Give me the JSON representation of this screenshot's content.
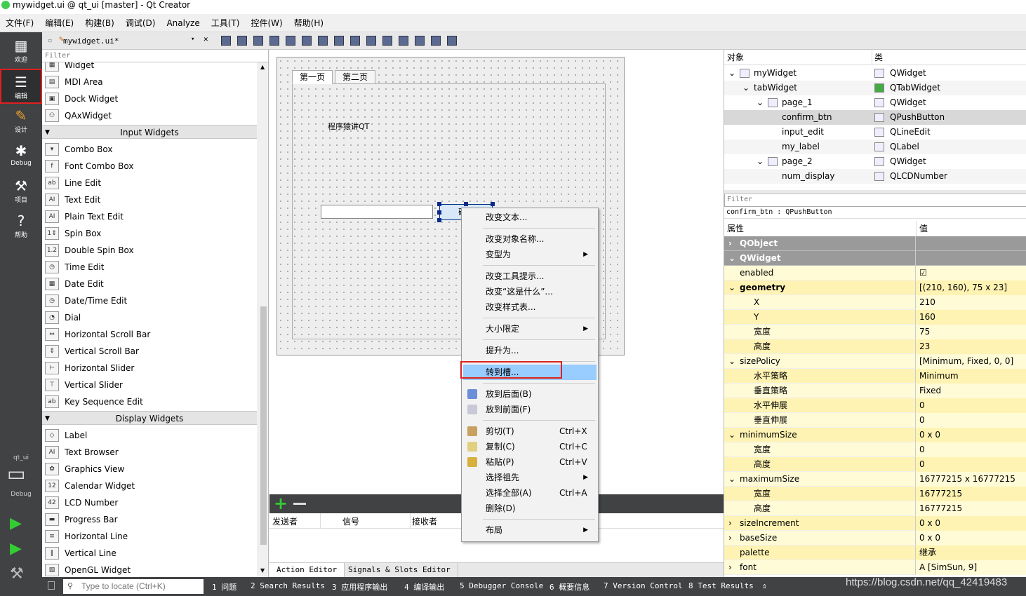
{
  "window": {
    "title": "mywidget.ui @ qt_ui [master] - Qt Creator"
  },
  "menu": [
    "文件(F)",
    "编辑(E)",
    "构建(B)",
    "调试(D)",
    "Analyze",
    "工具(T)",
    "控件(W)",
    "帮助(H)"
  ],
  "modes": [
    {
      "label": "欢迎",
      "icon": "grid-icon"
    },
    {
      "label": "编辑",
      "icon": "edit-doc-icon"
    },
    {
      "label": "设计",
      "icon": "pencil-icon"
    },
    {
      "label": "Debug",
      "icon": "bug-icon"
    },
    {
      "label": "项目",
      "icon": "wrench-icon"
    },
    {
      "label": "帮助",
      "icon": "help-icon"
    }
  ],
  "kit": {
    "project": "qt_ui",
    "config": "Debug"
  },
  "editor": {
    "document": "mywidget.ui*"
  },
  "widgetbox": {
    "filter_placeholder": "Filter",
    "top_items": [
      {
        "label": "Widget",
        "icon": "▦"
      },
      {
        "label": "MDI Area",
        "icon": "▤"
      },
      {
        "label": "Dock Widget",
        "icon": "▣"
      },
      {
        "label": "QAxWidget",
        "icon": "⚇"
      }
    ],
    "input_title": "Input Widgets",
    "input_items": [
      {
        "label": "Combo Box",
        "icon": "▾"
      },
      {
        "label": "Font Combo Box",
        "icon": "f"
      },
      {
        "label": "Line Edit",
        "icon": "ab"
      },
      {
        "label": "Text Edit",
        "icon": "AI"
      },
      {
        "label": "Plain Text Edit",
        "icon": "AI"
      },
      {
        "label": "Spin Box",
        "icon": "1⇕"
      },
      {
        "label": "Double Spin Box",
        "icon": "1.2"
      },
      {
        "label": "Time Edit",
        "icon": "◷"
      },
      {
        "label": "Date Edit",
        "icon": "▦"
      },
      {
        "label": "Date/Time Edit",
        "icon": "◷"
      },
      {
        "label": "Dial",
        "icon": "◔"
      },
      {
        "label": "Horizontal Scroll Bar",
        "icon": "⇔"
      },
      {
        "label": "Vertical Scroll Bar",
        "icon": "⇕"
      },
      {
        "label": "Horizontal Slider",
        "icon": "⊢"
      },
      {
        "label": "Vertical Slider",
        "icon": "⊤"
      },
      {
        "label": "Key Sequence Edit",
        "icon": "ab"
      }
    ],
    "display_title": "Display Widgets",
    "display_items": [
      {
        "label": "Label",
        "icon": "◇"
      },
      {
        "label": "Text Browser",
        "icon": "AI"
      },
      {
        "label": "Graphics View",
        "icon": "✿"
      },
      {
        "label": "Calendar Widget",
        "icon": "12"
      },
      {
        "label": "LCD Number",
        "icon": "42"
      },
      {
        "label": "Progress Bar",
        "icon": "▬"
      },
      {
        "label": "Horizontal Line",
        "icon": "≡"
      },
      {
        "label": "Vertical Line",
        "icon": "‖"
      },
      {
        "label": "OpenGL Widget",
        "icon": "▨"
      }
    ]
  },
  "form": {
    "tabs": [
      "第一页",
      "第二页"
    ],
    "label_text": "程序猿讲QT",
    "button_text": "确定"
  },
  "context_menu": {
    "items": [
      {
        "label": "改变文本...",
        "sc": "",
        "sub": false,
        "sep_after": true
      },
      {
        "label": "改变对象名称...",
        "sc": "",
        "sub": false,
        "sep_after": false
      },
      {
        "label": "变型为",
        "sc": "",
        "sub": true,
        "sep_after": true
      },
      {
        "label": "改变工具提示...",
        "sc": "",
        "sub": false,
        "sep_after": false
      },
      {
        "label": "改变“这是什么”...",
        "sc": "",
        "sub": false,
        "sep_after": false
      },
      {
        "label": "改变样式表...",
        "sc": "",
        "sub": false,
        "sep_after": true
      },
      {
        "label": "大小限定",
        "sc": "",
        "sub": true,
        "sep_after": true
      },
      {
        "label": "提升为...",
        "sc": "",
        "sub": false,
        "sep_after": true
      },
      {
        "label": "转到槽...",
        "sc": "",
        "sub": false,
        "sep_after": true,
        "hl": true
      },
      {
        "label": "放到后面(B)",
        "sc": "",
        "sub": false,
        "sep_after": false,
        "icon": "#6a8ed8"
      },
      {
        "label": "放到前面(F)",
        "sc": "",
        "sub": false,
        "sep_after": true,
        "icon": "#c8c8d8"
      },
      {
        "label": "剪切(T)",
        "sc": "Ctrl+X",
        "sub": false,
        "sep_after": false,
        "icon": "#c8a060"
      },
      {
        "label": "复制(C)",
        "sc": "Ctrl+C",
        "sub": false,
        "sep_after": false,
        "icon": "#e0d080"
      },
      {
        "label": "粘贴(P)",
        "sc": "Ctrl+V",
        "sub": false,
        "sep_after": false,
        "icon": "#d8b040"
      },
      {
        "label": "选择祖先",
        "sc": "",
        "sub": true,
        "sep_after": false
      },
      {
        "label": "选择全部(A)",
        "sc": "Ctrl+A",
        "sub": false,
        "sep_after": false
      },
      {
        "label": "删除(D)",
        "sc": "",
        "sub": false,
        "sep_after": true
      },
      {
        "label": "布局",
        "sc": "",
        "sub": true,
        "sep_after": false
      }
    ]
  },
  "signals": {
    "columns": [
      "发送者",
      "信号",
      "接收者"
    ]
  },
  "bottom_tabs": [
    "Action Editor",
    "Signals & Slots Editor"
  ],
  "object_inspector": {
    "col_object": "对象",
    "col_class": "类",
    "rows": [
      {
        "name": "myWidget",
        "cls": "QWidget",
        "indent": 0,
        "exp": "⌄"
      },
      {
        "name": "tabWidget",
        "cls": "QTabWidget",
        "indent": 1,
        "exp": "⌄"
      },
      {
        "name": "page_1",
        "cls": "QWidget",
        "indent": 2,
        "exp": "⌄"
      },
      {
        "name": "confirm_btn",
        "cls": "QPushButton",
        "indent": 3,
        "exp": "",
        "sel": true
      },
      {
        "name": "input_edit",
        "cls": "QLineEdit",
        "indent": 3,
        "exp": ""
      },
      {
        "name": "my_label",
        "cls": "QLabel",
        "indent": 3,
        "exp": ""
      },
      {
        "name": "page_2",
        "cls": "QWidget",
        "indent": 2,
        "exp": "⌄"
      },
      {
        "name": "num_display",
        "cls": "QLCDNumber",
        "indent": 3,
        "exp": ""
      }
    ]
  },
  "property_editor": {
    "filter_placeholder": "Filter",
    "current": "confirm_btn : QPushButton",
    "col_prop": "属性",
    "col_value": "值",
    "rows": [
      {
        "n": "QObject",
        "v": "",
        "t": "grp",
        "exp": "›"
      },
      {
        "n": "QWidget",
        "v": "",
        "t": "grp",
        "exp": "⌄"
      },
      {
        "n": "enabled",
        "v": "☑",
        "t": "py",
        "i": 1
      },
      {
        "n": "geometry",
        "v": "[(210, 160), 75 x 23]",
        "t": "py2",
        "i": 0,
        "b": true,
        "exp": "⌄"
      },
      {
        "n": "X",
        "v": "210",
        "t": "py",
        "i": 2
      },
      {
        "n": "Y",
        "v": "160",
        "t": "py2",
        "i": 2
      },
      {
        "n": "宽度",
        "v": "75",
        "t": "py",
        "i": 2
      },
      {
        "n": "高度",
        "v": "23",
        "t": "py2",
        "i": 2
      },
      {
        "n": "sizePolicy",
        "v": "[Minimum, Fixed, 0, 0]",
        "t": "py",
        "i": 1,
        "exp": "⌄"
      },
      {
        "n": "水平策略",
        "v": "Minimum",
        "t": "py2",
        "i": 2
      },
      {
        "n": "垂直策略",
        "v": "Fixed",
        "t": "py",
        "i": 2
      },
      {
        "n": "水平伸展",
        "v": "0",
        "t": "py2",
        "i": 2
      },
      {
        "n": "垂直伸展",
        "v": "0",
        "t": "py",
        "i": 2
      },
      {
        "n": "minimumSize",
        "v": "0 x 0",
        "t": "py2",
        "i": 1,
        "exp": "⌄"
      },
      {
        "n": "宽度",
        "v": "0",
        "t": "py",
        "i": 2
      },
      {
        "n": "高度",
        "v": "0",
        "t": "py2",
        "i": 2
      },
      {
        "n": "maximumSize",
        "v": "16777215 x 16777215",
        "t": "py",
        "i": 1,
        "exp": "⌄"
      },
      {
        "n": "宽度",
        "v": "16777215",
        "t": "py2",
        "i": 2
      },
      {
        "n": "高度",
        "v": "16777215",
        "t": "py",
        "i": 2
      },
      {
        "n": "sizeIncrement",
        "v": "0 x 0",
        "t": "py2",
        "i": 1,
        "exp": "›"
      },
      {
        "n": "baseSize",
        "v": "0 x 0",
        "t": "py",
        "i": 1,
        "exp": "›"
      },
      {
        "n": "palette",
        "v": "继承",
        "t": "py2",
        "i": 1
      },
      {
        "n": "font",
        "v": "A  [SimSun, 9]",
        "t": "py",
        "i": 1,
        "exp": "›"
      }
    ]
  },
  "status": {
    "locate_placeholder": "Type to locate (Ctrl+K)",
    "panes": [
      "1  问题",
      "2  Search Results",
      "3  应用程序输出",
      "4  编译输出",
      "5  Debugger Console",
      "6  概要信息",
      "7  Version Control",
      "8  Test Results"
    ]
  },
  "watermark": "https://blog.csdn.net/qq_42419483"
}
